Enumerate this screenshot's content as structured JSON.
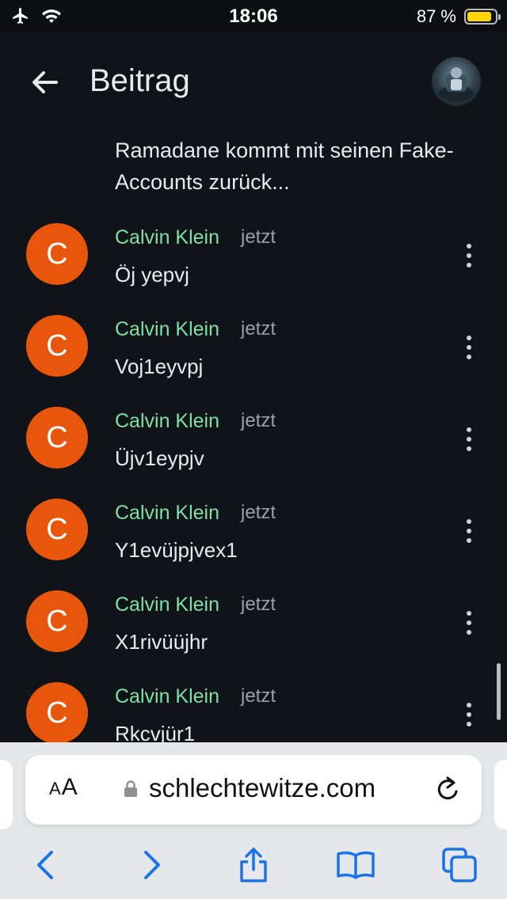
{
  "status_bar": {
    "time": "18:06",
    "battery_percent": "87 %",
    "battery_level": 0.87,
    "icons": [
      "airplane-icon",
      "wifi-icon",
      "battery-icon"
    ]
  },
  "header": {
    "title": "Beitrag",
    "back_icon": "arrow-left-icon"
  },
  "post": {
    "text": "Ramadane kommt mit seinen Fake-Accounts zurück..."
  },
  "comments": [
    {
      "initial": "C",
      "author": "Calvin Klein",
      "time": "jetzt",
      "text": "Öj yepvj"
    },
    {
      "initial": "C",
      "author": "Calvin Klein",
      "time": "jetzt",
      "text": "Voj1eyvpj"
    },
    {
      "initial": "C",
      "author": "Calvin Klein",
      "time": "jetzt",
      "text": "Üjv1eypjv"
    },
    {
      "initial": "C",
      "author": "Calvin Klein",
      "time": "jetzt",
      "text": "Y1evüjpjvex1"
    },
    {
      "initial": "C",
      "author": "Calvin Klein",
      "time": "jetzt",
      "text": "X1rivüüjhr"
    },
    {
      "initial": "C",
      "author": "Calvin Klein",
      "time": "jetzt",
      "text": "Rkcvjür1"
    }
  ],
  "browser": {
    "text_size_label": "AA",
    "url": "schlechtewitze.com",
    "toolbar_icons": [
      "back-icon",
      "forward-icon",
      "share-icon",
      "bookmarks-icon",
      "tabs-icon"
    ]
  },
  "colors": {
    "background": "#101418",
    "accent_author": "#7ee0a5",
    "avatar": "#e8560c",
    "safari_blue": "#1a73e8"
  }
}
